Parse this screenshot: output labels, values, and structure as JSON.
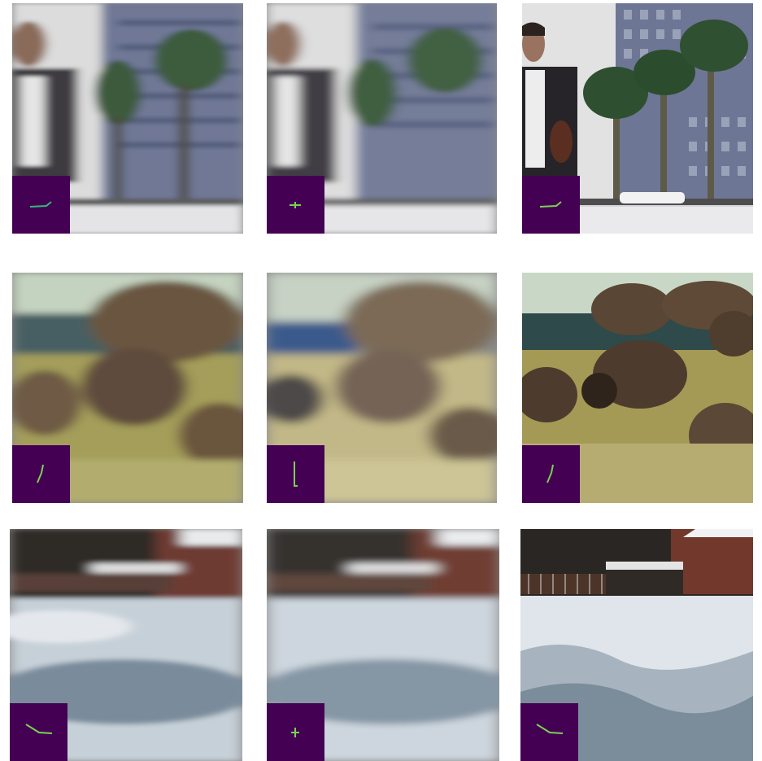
{
  "grid": {
    "rows": [
      {
        "scene": "street-mural",
        "tiles": [
          {
            "kind": "blurred-input",
            "blur": "strong",
            "kernel": "hook-right"
          },
          {
            "kind": "restored-estimate",
            "blur": "strong",
            "kernel": "small-cross"
          },
          {
            "kind": "sharp-reference",
            "blur": "none",
            "kernel": "hook-right"
          }
        ]
      },
      {
        "scene": "bison-herd",
        "tiles": [
          {
            "kind": "blurred-input",
            "blur": "strong",
            "kernel": "diagonal-stroke"
          },
          {
            "kind": "restored-estimate",
            "blur": "strong",
            "kernel": "vertical-stroke"
          },
          {
            "kind": "sharp-reference",
            "blur": "none",
            "kernel": "diagonal-stroke"
          }
        ]
      },
      {
        "scene": "snow-field",
        "tiles": [
          {
            "kind": "blurred-input",
            "blur": "strong",
            "kernel": "descending-bend"
          },
          {
            "kind": "restored-estimate",
            "blur": "strong",
            "kernel": "tiny-plus"
          },
          {
            "kind": "sharp-reference",
            "blur": "none",
            "kernel": "descending-bend"
          }
        ]
      }
    ]
  },
  "colors": {
    "kernel_background": "#440154",
    "kernel_stroke": "#7ad151",
    "kernel_stroke_alt": "#35b779"
  }
}
